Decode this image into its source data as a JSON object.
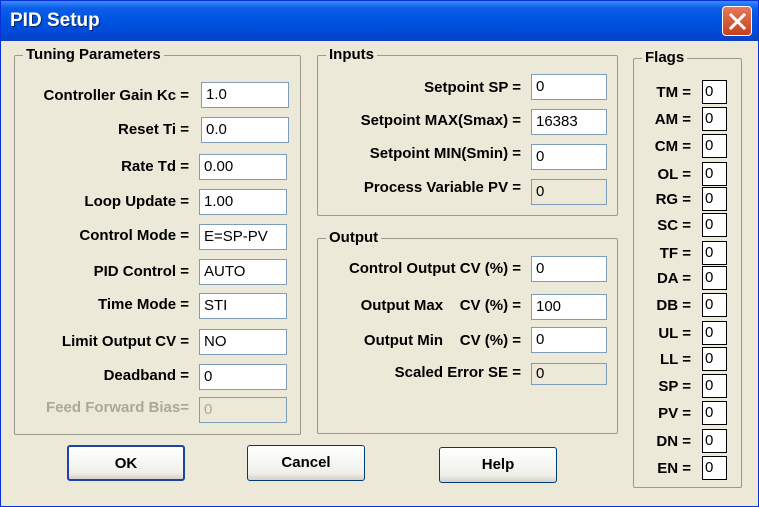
{
  "window": {
    "title": "PID Setup"
  },
  "tuning": {
    "legend": "Tuning Parameters",
    "fields": [
      {
        "label": "Controller Gain Kc =",
        "value": "1.0"
      },
      {
        "label": "Reset Ti =",
        "value": "0.0"
      },
      {
        "label": "Rate Td =",
        "value": "0.00"
      },
      {
        "label": "Loop Update =",
        "value": "1.00"
      },
      {
        "label": "Control Mode =",
        "value": "E=SP-PV"
      },
      {
        "label": "PID Control =",
        "value": "AUTO"
      },
      {
        "label": "Time Mode =",
        "value": "STI"
      },
      {
        "label": "Limit Output CV =",
        "value": "NO"
      },
      {
        "label": "Deadband =",
        "value": "0"
      },
      {
        "label": "Feed Forward Bias=",
        "value": "0"
      }
    ]
  },
  "inputs": {
    "legend": "Inputs",
    "fields": [
      {
        "label": "Setpoint SP =",
        "value": "0"
      },
      {
        "label": "Setpoint MAX(Smax) =",
        "value": "16383"
      },
      {
        "label": "Setpoint MIN(Smin) =",
        "value": "0"
      },
      {
        "label": "Process Variable PV =",
        "value": "0"
      }
    ]
  },
  "output": {
    "legend": "Output",
    "fields": [
      {
        "label": "Control Output CV (%) =",
        "value": "0"
      },
      {
        "label": "Output Max    CV (%) =",
        "value": "100"
      },
      {
        "label": "Output Min    CV (%) =",
        "value": "0"
      },
      {
        "label": "Scaled Error SE =",
        "value": "0"
      }
    ]
  },
  "flags": {
    "legend": "Flags",
    "items": [
      {
        "label": "TM =",
        "value": "0"
      },
      {
        "label": "AM =",
        "value": "0"
      },
      {
        "label": "CM =",
        "value": "0"
      },
      {
        "label": "OL =",
        "value": "0"
      },
      {
        "label": "RG =",
        "value": "0"
      },
      {
        "label": "SC =",
        "value": "0"
      },
      {
        "label": "TF =",
        "value": "0"
      },
      {
        "label": "DA =",
        "value": "0"
      },
      {
        "label": "DB =",
        "value": "0"
      },
      {
        "label": "UL =",
        "value": "0"
      },
      {
        "label": "LL =",
        "value": "0"
      },
      {
        "label": "SP =",
        "value": "0"
      },
      {
        "label": "PV =",
        "value": "0"
      },
      {
        "label": "DN =",
        "value": "0"
      },
      {
        "label": "EN =",
        "value": "0"
      }
    ]
  },
  "buttons": {
    "ok": "OK",
    "cancel": "Cancel",
    "help": "Help"
  }
}
